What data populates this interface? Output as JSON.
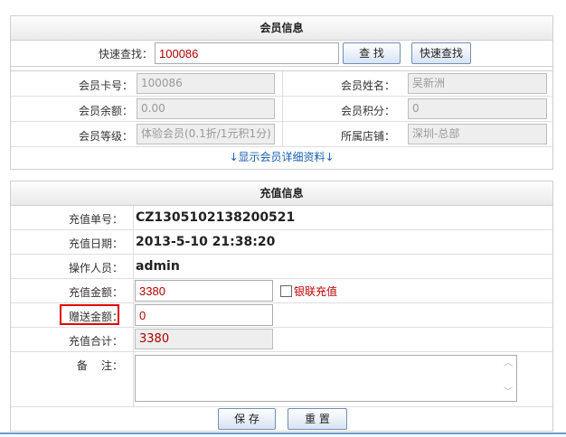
{
  "member": {
    "title": "会员信息",
    "quick_search_label": "快速查找：",
    "quick_search_value": "100086",
    "find_button": "查  找",
    "quick_find_button": "快速查找",
    "card_no_label": "会员卡号：",
    "card_no_value": "100086",
    "name_label": "会员姓名：",
    "name_value": "吴新洲",
    "balance_label": "会员余额：",
    "balance_value": "0.00",
    "points_label": "会员积分：",
    "points_value": "0",
    "level_label": "会员等级：",
    "level_value": "体验会员(0.1折/1元积1分)",
    "store_label": "所属店铺：",
    "store_value": "深圳-总部",
    "details_link": "↓显示会员详细资料↓"
  },
  "recharge": {
    "title": "充值信息",
    "order_no_label": "充值单号：",
    "order_no_value": "CZ1305102138200521",
    "date_label": "充值日期：",
    "date_value": "2013-5-10 21:38:20",
    "operator_label": "操作人员：",
    "operator_value": "admin",
    "amount_label": "充值金额：",
    "amount_value": "3380",
    "unionpay_label": "银联充值",
    "bonus_label": "赠送金额：",
    "bonus_value": "0",
    "total_label": "充值合计：",
    "total_value": "3380",
    "remark_label": "备    注：",
    "remark_value": "",
    "save_button": "保  存",
    "reset_button": "重  置"
  },
  "colors": {
    "highlight_border": "#e00000",
    "accent_link": "#1a5fb4",
    "value_red": "#c00000"
  }
}
